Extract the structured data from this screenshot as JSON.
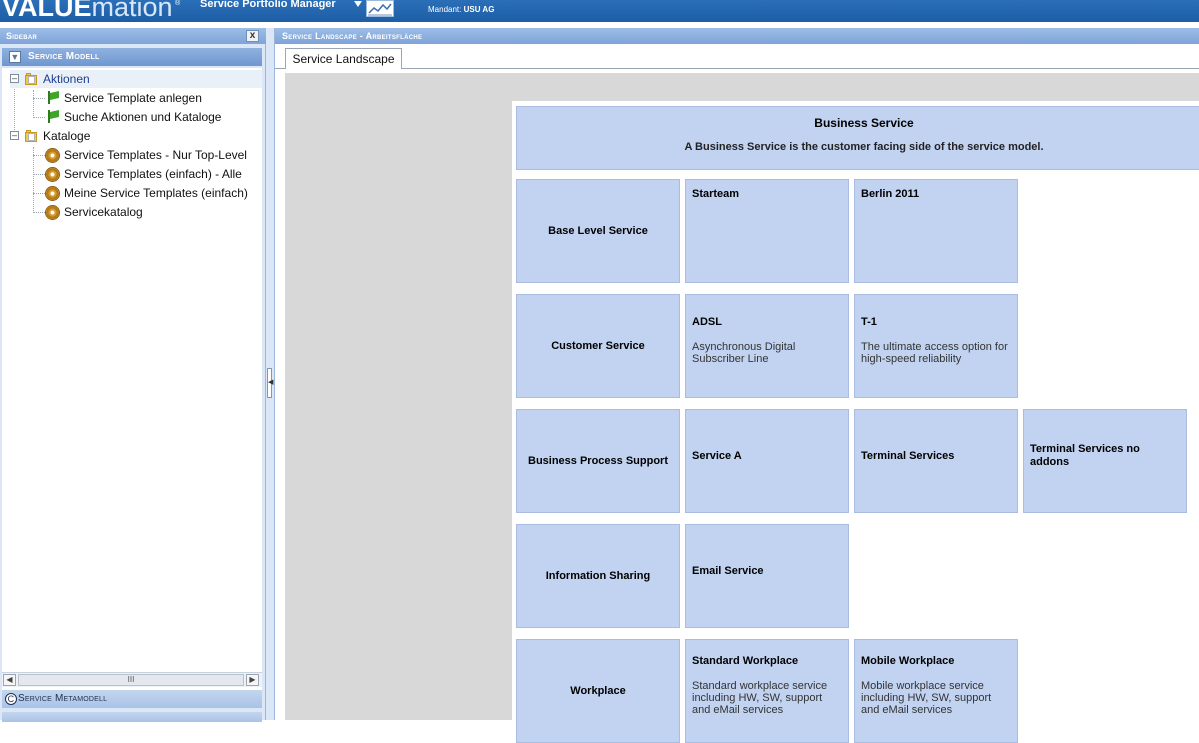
{
  "header": {
    "logo_bold": "VALUE",
    "logo_light": "mation",
    "logo_reg": "®",
    "module_title": "Service Portfolio Manager",
    "mandant_label": "Mandant:",
    "mandant_value": "USU AG"
  },
  "sidebar": {
    "title": "Sidebar",
    "close_label": "x",
    "section_title": "Service Modell",
    "tree": {
      "aktionen": {
        "label": "Aktionen",
        "children": [
          "Service Template anlegen",
          "Suche Aktionen und Kataloge"
        ]
      },
      "kataloge": {
        "label": "Kataloge",
        "children": [
          "Service Templates - Nur Top-Level",
          "Service Templates (einfach) - Alle",
          "Meine Service Templates (einfach)",
          "Servicekatalog"
        ]
      }
    },
    "scroll_thumb": "III",
    "meta_section": "Service Metamodell",
    "meta_icon": "C"
  },
  "main": {
    "title": "Service Landscape - Arbeitsfläche",
    "tab_label": "Service Landscape"
  },
  "landscape": {
    "header_title": "Business Service",
    "header_desc": "A Business Service is the customer facing side of the service model.",
    "rows": [
      {
        "label": "Base Level Service"
      },
      {
        "label": "Customer Service"
      },
      {
        "label": "Business Process Support"
      },
      {
        "label": "Information Sharing"
      },
      {
        "label": "Workplace"
      }
    ],
    "cells": {
      "starteam": {
        "title": "Starteam"
      },
      "berlin": {
        "title": "Berlin 2011"
      },
      "adsl": {
        "title": "ADSL",
        "desc": "Asynchronous Digital Subscriber Line"
      },
      "t1": {
        "title": "T-1",
        "desc": "The ultimate access option for high-speed reliability"
      },
      "service_a": {
        "title": "Service A"
      },
      "terminal": {
        "title": "Terminal Services"
      },
      "terminal_no": {
        "title": "Terminal Services no addons"
      },
      "email": {
        "title": "Email Service"
      },
      "std_workplace": {
        "title": "Standard Workplace",
        "desc": "Standard workplace service including HW, SW, support and eMail services"
      },
      "mob_workplace": {
        "title": "Mobile Workplace",
        "desc": "Mobile workplace service including HW, SW, support and eMail services"
      }
    }
  },
  "colors": {
    "header_bg": "#1d5ea6",
    "cell_bg": "#c1d3f1",
    "panel_title_bg": "#8fb1e0"
  }
}
